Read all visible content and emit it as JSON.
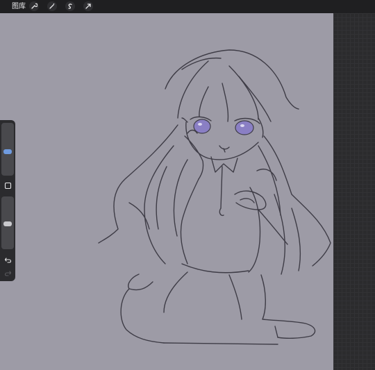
{
  "topbar": {
    "gallery_label": "图库",
    "tools": [
      "wrench-icon",
      "magic-wand-icon",
      "selection-icon",
      "transform-arrow-icon"
    ]
  },
  "sidebar": {
    "brush_size_value": 0.45,
    "opacity_value": 0.55,
    "icons": [
      "modify-square-icon",
      "undo-icon",
      "redo-icon"
    ]
  },
  "colors": {
    "canvas": "#9d9ba6",
    "toolbar": "#1f1f21",
    "panel": "#2b2b2d",
    "sketch_line": "#3e3c46",
    "eye_fill": "#8a7fc4",
    "slider_thumb_active": "#6f9be0"
  }
}
